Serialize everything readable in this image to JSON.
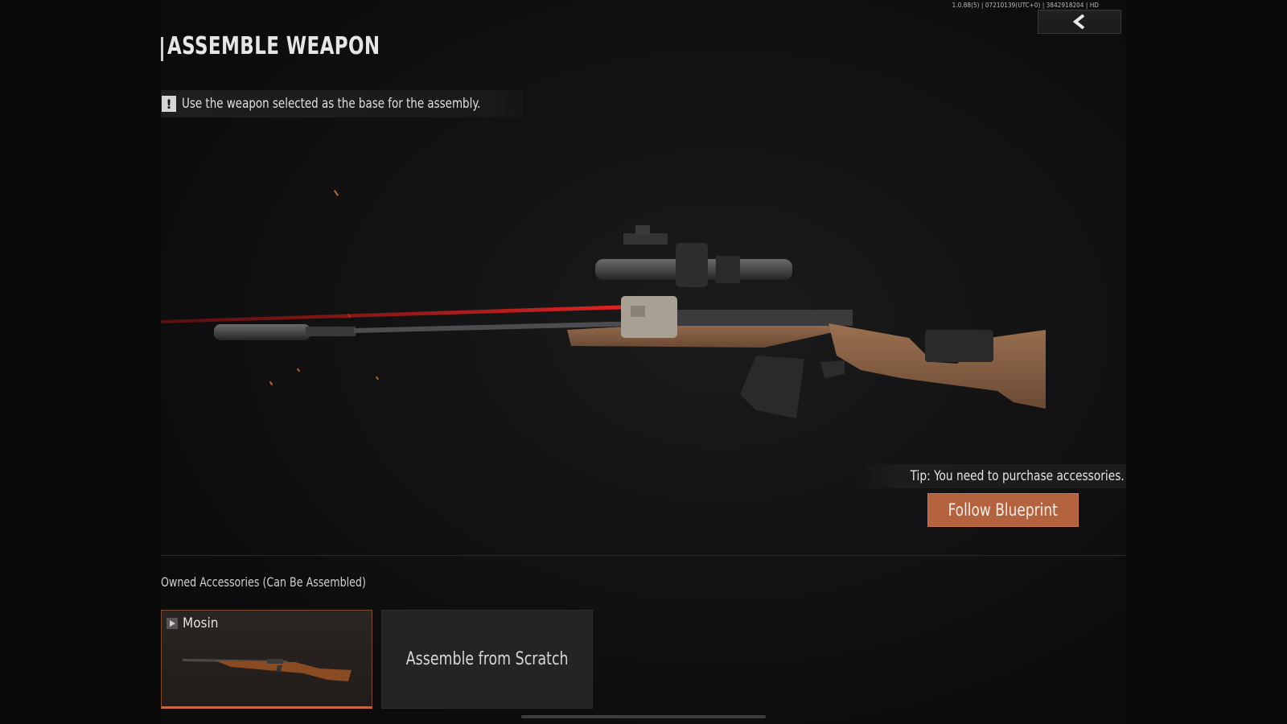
{
  "version_text": "1.0.88(5) | 07210139(UTC+0) | 3842918204 | HD",
  "header": {
    "title": "ASSEMBLE WEAPON",
    "back_icon": "chevron-left-icon"
  },
  "notice": {
    "icon": "exclamation-icon",
    "icon_glyph": "!",
    "text": "Use the weapon selected as the base for the assembly."
  },
  "tip": {
    "text": "Tip: You need to purchase accessories."
  },
  "blueprint_button": {
    "label": "Follow Blueprint"
  },
  "owned": {
    "label": "Owned Accessories (Can Be Assembled)",
    "items": [
      {
        "name": "Mosin",
        "icon": "play-icon",
        "selected": true
      }
    ],
    "scratch_label": "Assemble from Scratch"
  },
  "colors": {
    "accent": "#b5623f",
    "selected_border": "#c8663d",
    "laser": "#c81e1e",
    "background": "#0b0b0c"
  }
}
